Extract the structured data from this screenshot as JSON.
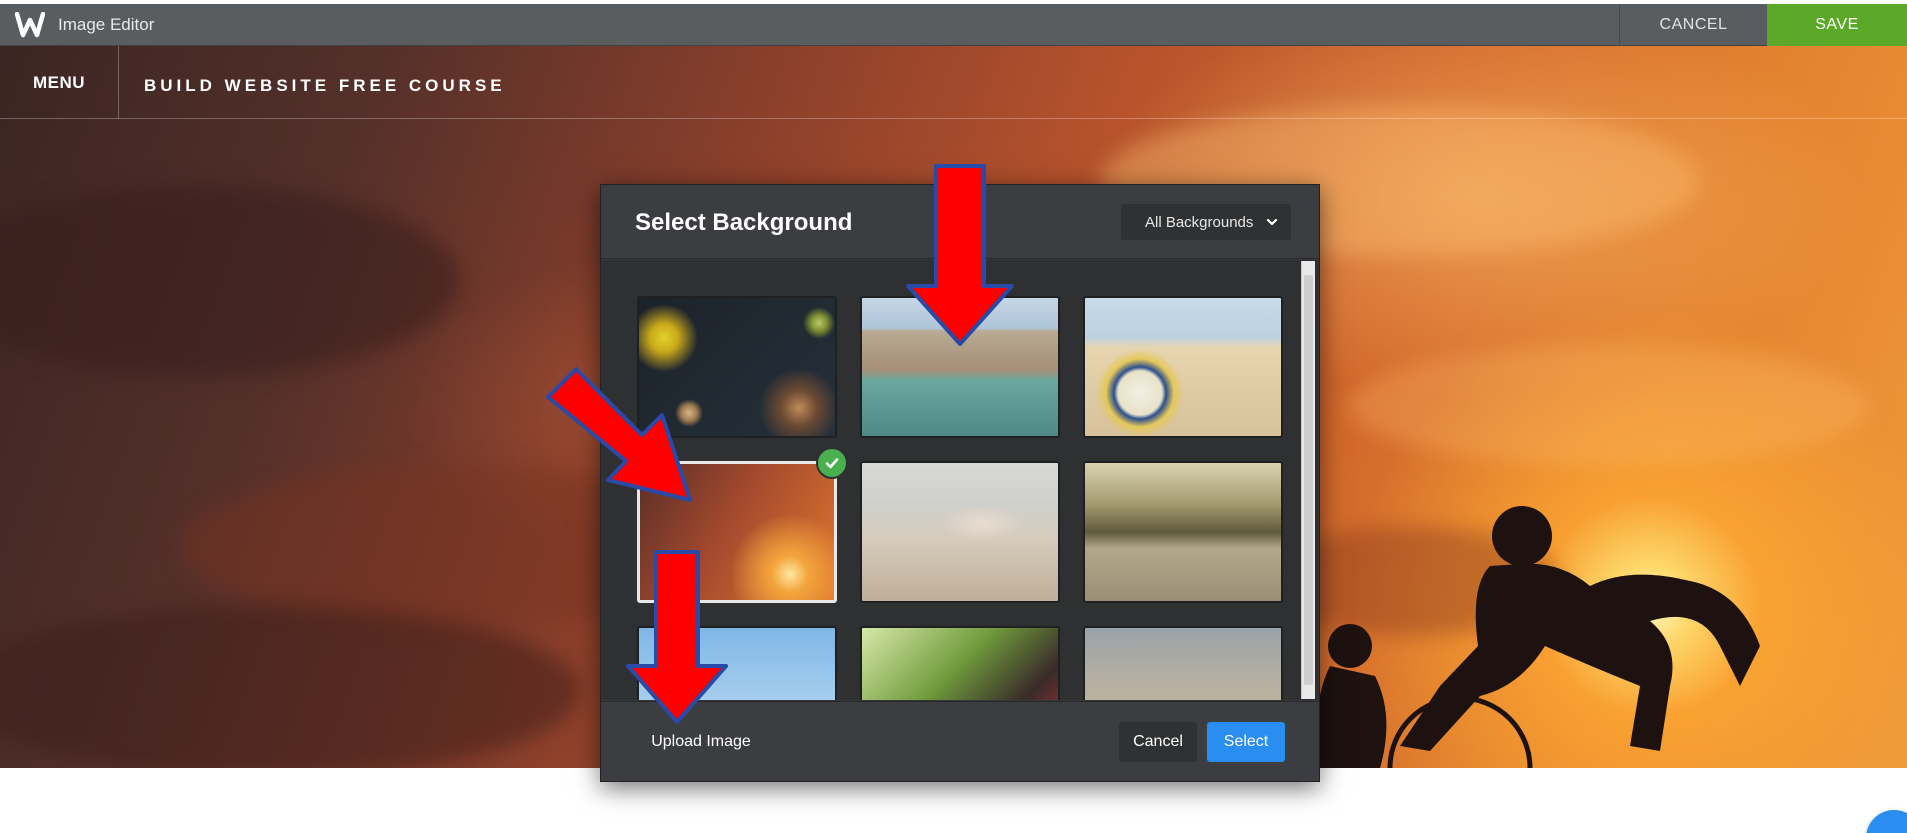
{
  "app": {
    "title": "Image Editor",
    "cancel_label": "CANCEL",
    "save_label": "SAVE",
    "logo_icon": "weebly-logo-icon"
  },
  "site": {
    "menu_label": "MENU",
    "title": "BUILD WEBSITE FREE COURSE"
  },
  "modal": {
    "title": "Select Background",
    "filter_selected": "All Backgrounds",
    "upload_label": "Upload Image",
    "cancel_label": "Cancel",
    "select_label": "Select"
  },
  "colors": {
    "save_green": "#5ca92a",
    "select_blue": "#2a8ef0",
    "check_green": "#49b04e",
    "arrow_red": "#ff0000",
    "arrow_outline": "#2a4aa8"
  }
}
